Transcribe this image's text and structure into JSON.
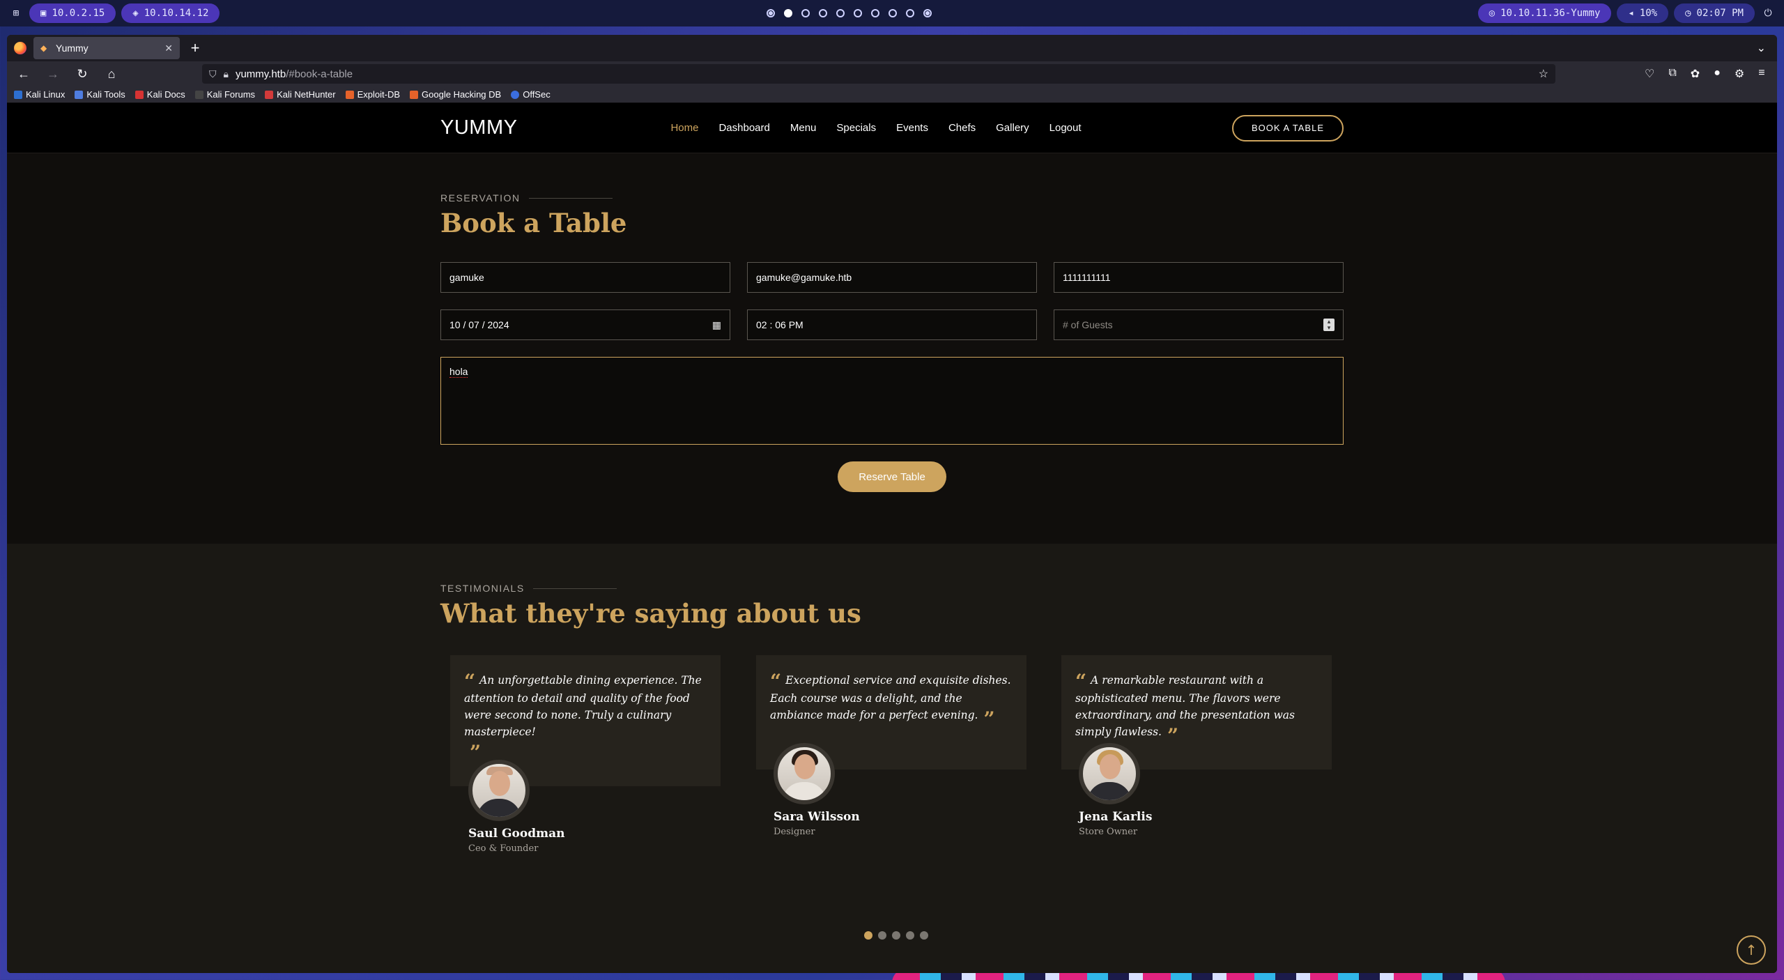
{
  "panel": {
    "menu_icon": "grid-icon",
    "chip1": "10.0.2.15",
    "chip2": "10.10.14.12",
    "target": "10.10.11.36-Yummy",
    "volume": "10%",
    "clock": "02:07 PM"
  },
  "browser": {
    "tab_title": "Yummy",
    "url_host": "yummy.htb",
    "url_path": "/#book-a-table",
    "bookmarks": [
      "Kali Linux",
      "Kali Tools",
      "Kali Docs",
      "Kali Forums",
      "Kali NetHunter",
      "Exploit-DB",
      "Google Hacking DB",
      "OffSec"
    ]
  },
  "site": {
    "logo": "YUMMY",
    "nav": [
      "Home",
      "Dashboard",
      "Menu",
      "Specials",
      "Events",
      "Chefs",
      "Gallery",
      "Logout"
    ],
    "book_button": "BOOK A TABLE"
  },
  "reservation": {
    "eyebrow": "RESERVATION",
    "title": "Book a Table",
    "name": "gamuke",
    "email": "gamuke@gamuke.htb",
    "phone": "1111111111",
    "date": "10 / 07 / 2024",
    "time": "02 : 06  PM",
    "guests_placeholder": "# of Guests",
    "message": "hola",
    "submit": "Reserve Table"
  },
  "testimonials": {
    "eyebrow": "TESTIMONIALS",
    "title": "What they're saying about us",
    "items": [
      {
        "quote": "An unforgettable dining experience. The attention to detail and quality of the food were second to none. Truly a culinary masterpiece!",
        "name": "Saul Goodman",
        "role": "Ceo & Founder"
      },
      {
        "quote": "Exceptional service and exquisite dishes. Each course was a delight, and the ambiance made for a perfect evening.",
        "name": "Sara Wilsson",
        "role": "Designer"
      },
      {
        "quote": "A remarkable restaurant with a sophisticated menu. The flavors were extraordinary, and the presentation was simply flawless.",
        "name": "Jena Karlis",
        "role": "Store Owner"
      }
    ]
  },
  "colors": {
    "accent": "#cda45e",
    "background": "#0e0d0c"
  }
}
